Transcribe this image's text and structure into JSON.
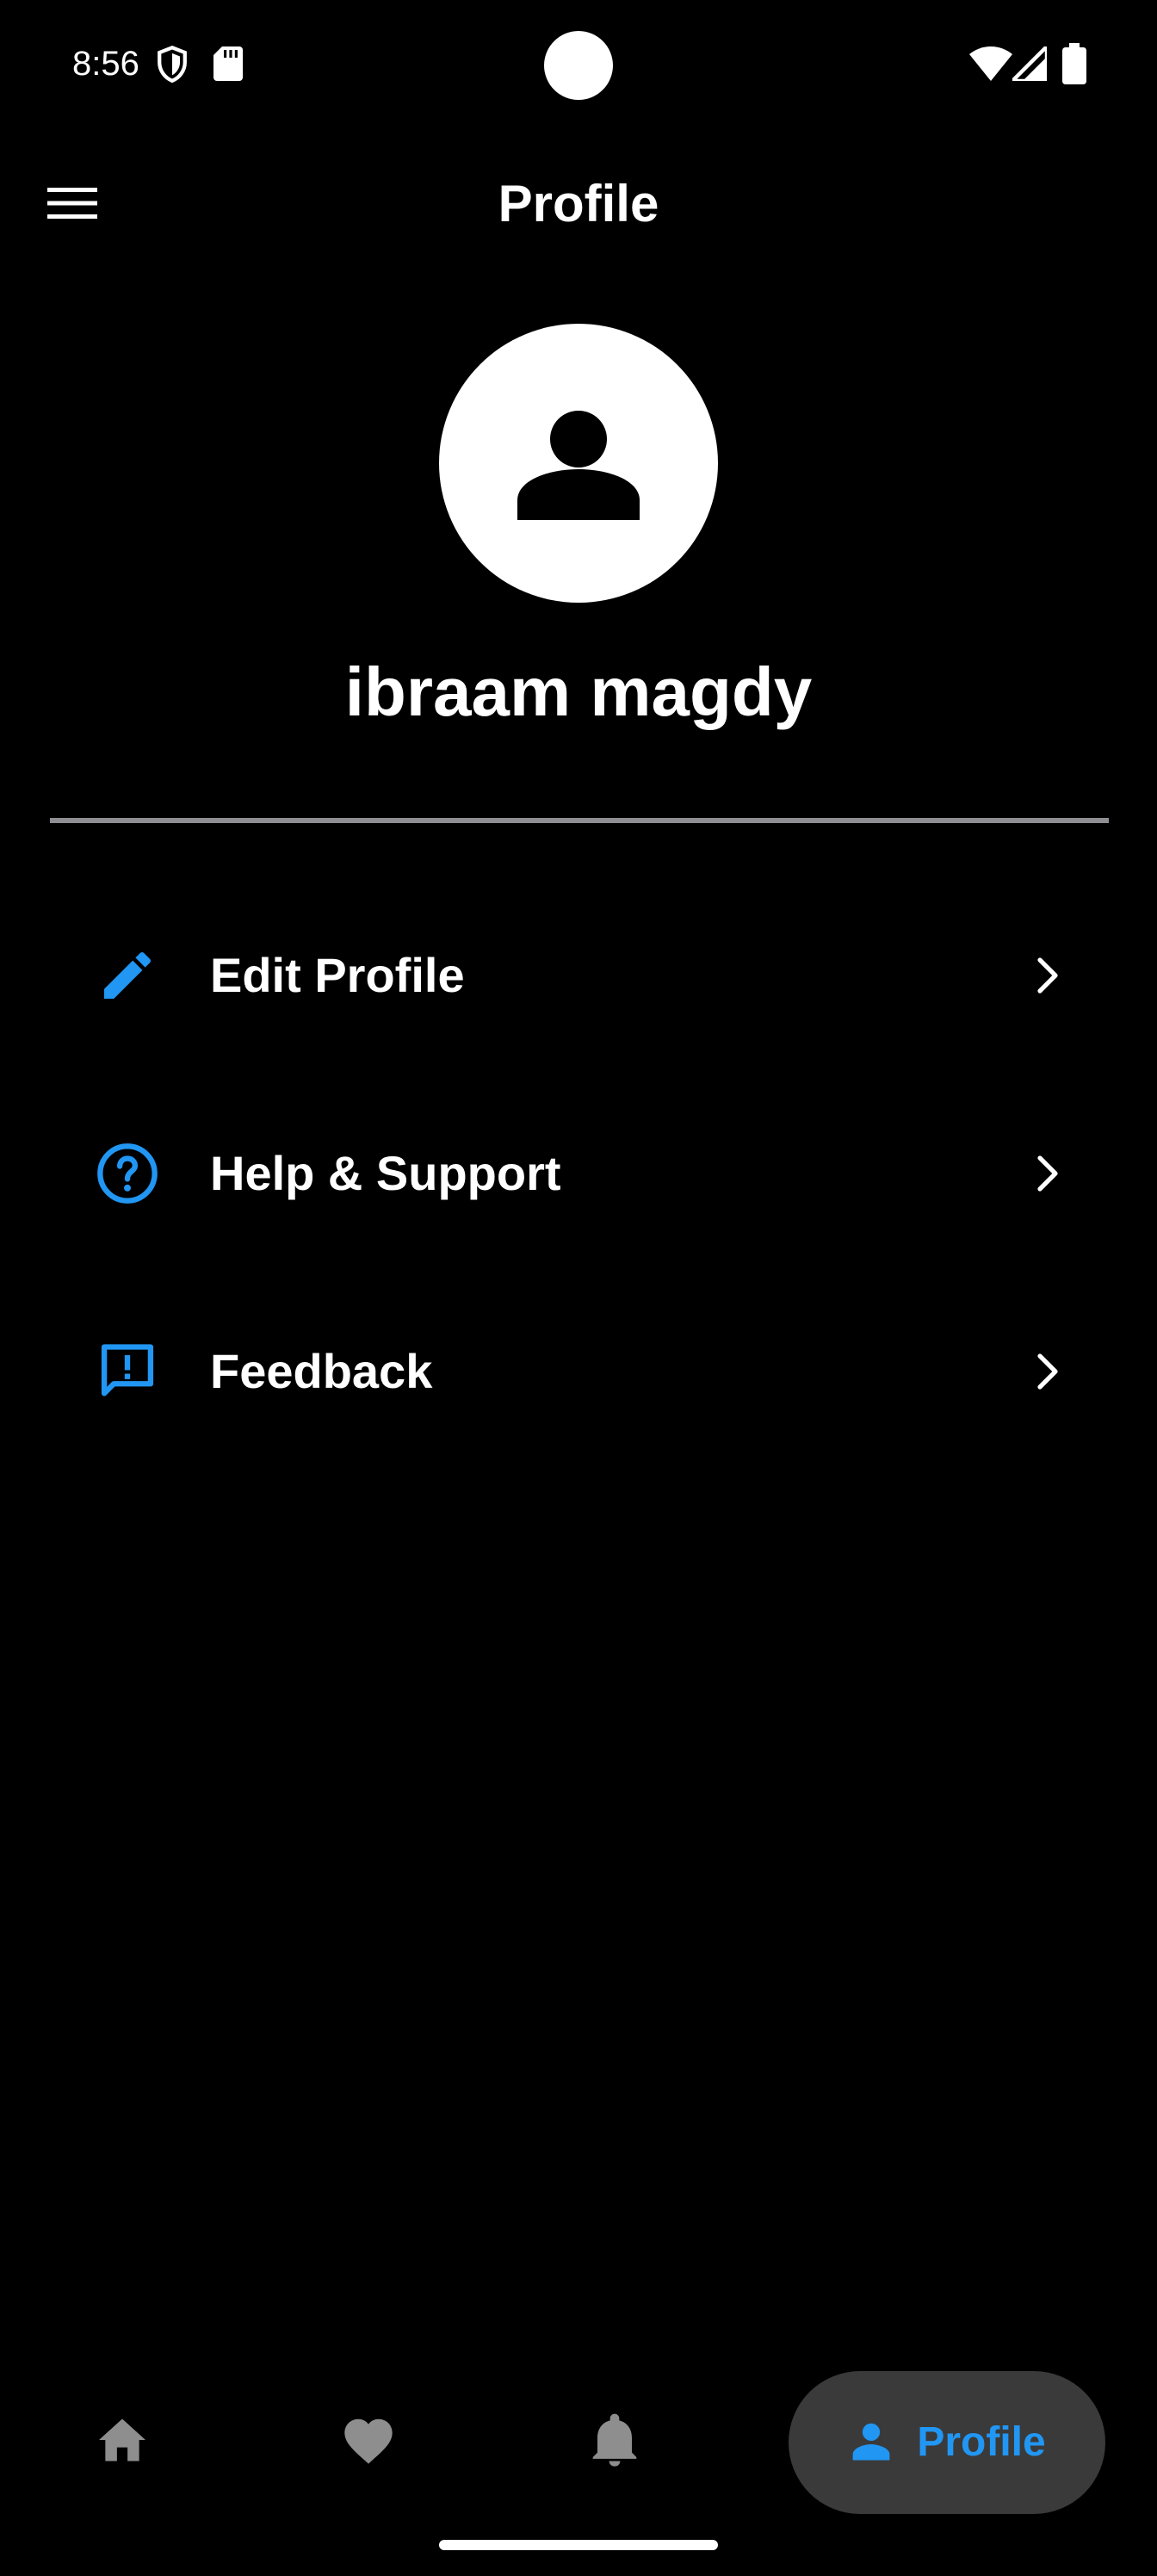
{
  "status_bar": {
    "time": "8:56",
    "icons": [
      "shield-icon",
      "sd-card-icon",
      "wifi-icon",
      "signal-icon",
      "battery-icon"
    ]
  },
  "app_bar": {
    "title": "Profile",
    "menu_icon": "hamburger-menu-icon"
  },
  "profile": {
    "avatar_icon": "person-icon",
    "name": "ibraam magdy"
  },
  "menu": {
    "items": [
      {
        "label": "Edit Profile",
        "icon": "pencil-icon"
      },
      {
        "label": "Help & Support",
        "icon": "help-circle-icon"
      },
      {
        "label": "Feedback",
        "icon": "feedback-icon"
      }
    ]
  },
  "bottom_nav": {
    "items": [
      {
        "icon": "home-icon",
        "label": ""
      },
      {
        "icon": "heart-icon",
        "label": ""
      },
      {
        "icon": "bell-icon",
        "label": ""
      },
      {
        "icon": "person-icon",
        "label": "Profile",
        "active": true
      }
    ]
  },
  "colors": {
    "background": "#000000",
    "accent": "#2196f3",
    "inactive_icon": "#8e8e8e",
    "active_pill": "#3a3a3a",
    "divider": "#8e8e93"
  }
}
